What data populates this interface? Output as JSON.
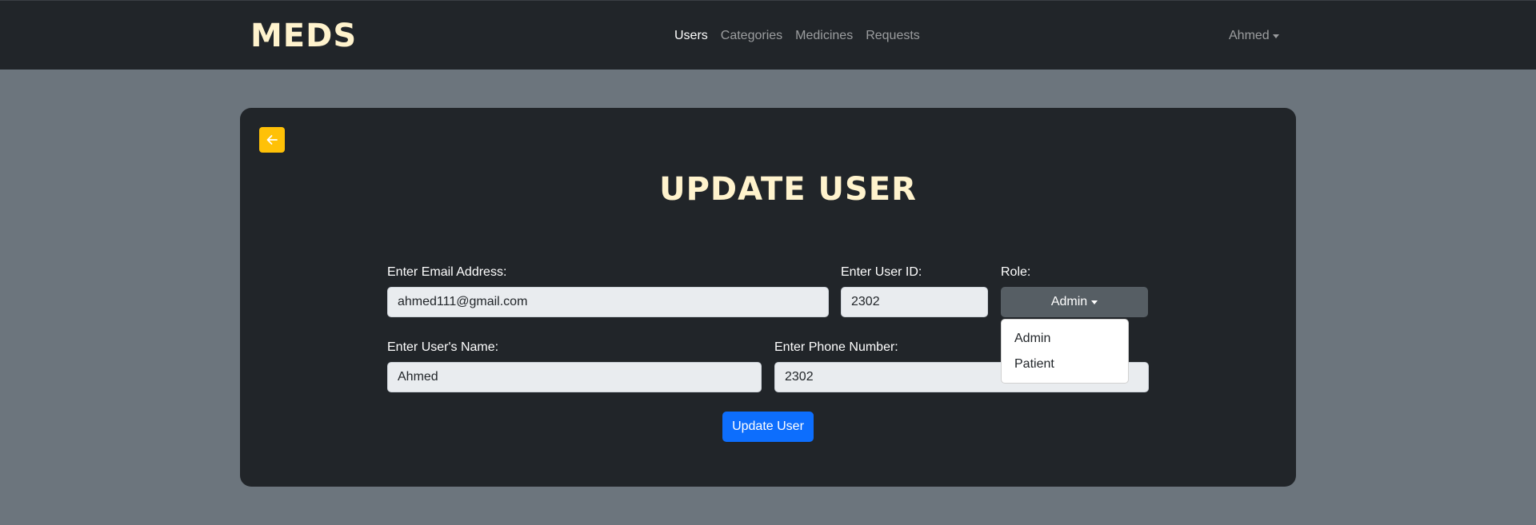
{
  "navbar": {
    "brand": "MEDS",
    "links": [
      "Users",
      "Categories",
      "Medicines",
      "Requests"
    ],
    "user_menu": "Ahmed"
  },
  "card": {
    "title": "UPDATE USER",
    "back_icon": "arrow-left-icon",
    "fields": {
      "email": {
        "label": "Enter Email Address:",
        "value": "ahmed111@gmail.com"
      },
      "user_id": {
        "label": "Enter User ID:",
        "value": "2302"
      },
      "role": {
        "label": "Role:",
        "value": "Admin",
        "options": [
          "Admin",
          "Patient"
        ]
      },
      "name": {
        "label": "Enter User's Name:",
        "value": "Ahmed"
      },
      "phone": {
        "label": "Enter Phone Number:",
        "value": "2302"
      }
    },
    "submit_label": "Update User"
  },
  "colors": {
    "page_bg": "#6c757d",
    "navbar_bg": "#212529",
    "card_bg": "#212529",
    "brand_text": "#fff3cd",
    "back_button": "#ffc107",
    "primary_button": "#0d6efd",
    "role_button": "#565e64"
  }
}
